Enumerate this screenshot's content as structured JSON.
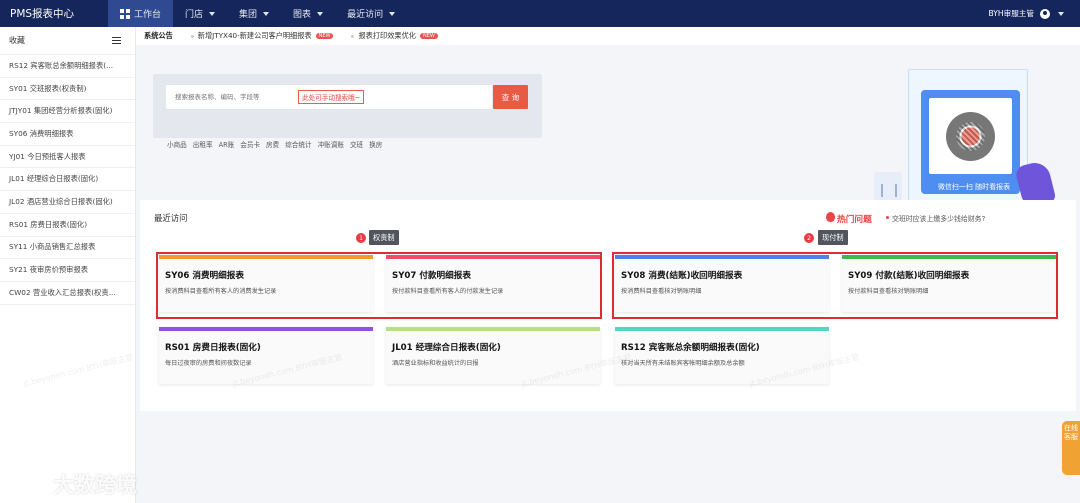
{
  "topbar": {
    "brand": "PMS报表中心",
    "nav": [
      {
        "label": "工作台"
      },
      {
        "label": "门店"
      },
      {
        "label": "集团"
      },
      {
        "label": "图表"
      },
      {
        "label": "最近访问"
      }
    ],
    "user": "BYH审服主管"
  },
  "sidebar": {
    "title": "收藏",
    "items": [
      "RS12 宾客账总余额明细报表(...",
      "SY01 交班报表(权责制)",
      "JTJY01 集团经营分析报表(固化)",
      "SY06 消费明细报表",
      "YJ01 今日预抵客人报表",
      "JL01 经理综合日报表(固化)",
      "JL02 酒店营业综合日报表(固化)",
      "RS01 房费日报表(固化)",
      "SY11 小商品销售汇总报表",
      "SY21 夜审房价预审报表",
      "CW02 营业收入汇总报表(权责..."
    ]
  },
  "notice": {
    "title": "系统公告",
    "items": [
      {
        "text": "新增JTYX40-新建公司客户明细报表",
        "badge": "NEW"
      },
      {
        "text": "报表打印效果优化",
        "badge": "NEW"
      }
    ]
  },
  "search": {
    "placeholder": "搜索报表名称、编码、字段等",
    "hint": "此处可手动搜索哦~",
    "button": "查 询",
    "quick_links": [
      "小商品",
      "出租率",
      "AR账",
      "会员卡",
      "房费",
      "综合统计",
      "冲账调账",
      "交班",
      "换房"
    ]
  },
  "promo": {
    "text": "微信扫一扫 随时看报表"
  },
  "recent": {
    "title": "最近访问",
    "hot_title": "热门问题",
    "hot_question": "交班时应该上缴多少钱给财务?",
    "badges": [
      {
        "number": "1",
        "label": "权责制"
      },
      {
        "number": "2",
        "label": "现付制"
      }
    ],
    "cards": [
      {
        "title": "SY06 消费明细报表",
        "desc": "按消费科目查看所有客人的消费发生记录",
        "color": "#f29a31"
      },
      {
        "title": "SY07 付款明细报表",
        "desc": "按付款科目查看所有客人的付款发生记录",
        "color": "#f14b65"
      },
      {
        "title": "SY08 消费(结账)收回明细报表",
        "desc": "按消费科目查看核对销账明细",
        "color": "#4e80e6"
      },
      {
        "title": "SY09 付款(结账)收回明细报表",
        "desc": "按付款科目查看核对销账明细",
        "color": "#44b54d"
      },
      {
        "title": "RS01 房费日报表(固化)",
        "desc": "每日过夜审的房费和间夜数记录",
        "color": "#8f54d9"
      },
      {
        "title": "JL01 经理综合日报表(固化)",
        "desc": "酒店营业指标和收益统计的日报",
        "color": "#b8e083"
      },
      {
        "title": "RS12 宾客账总余额明细报表(固化)",
        "desc": "核对当天所有未结账宾客帐明细余额及总余额",
        "color": "#55d4c1"
      }
    ]
  },
  "watermark": "jt.beyondh.com BYH审服主管",
  "logo": "大数跨境",
  "online_service": "在线客服"
}
